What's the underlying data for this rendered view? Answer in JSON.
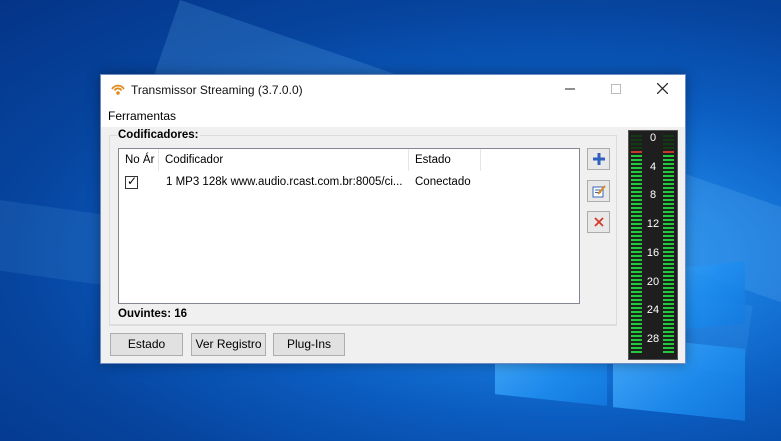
{
  "window": {
    "title": "Transmissor Streaming (3.7.0.0)",
    "controls": {
      "minimize": "—",
      "maximize": "☐",
      "close": "✕"
    }
  },
  "menu": {
    "items": [
      "Ferramentas"
    ]
  },
  "encoders": {
    "group_title": "Codificadores:",
    "columns": [
      "No Ár",
      "Codificador",
      "Estado"
    ],
    "rows": [
      {
        "on_air": true,
        "codificador": "1 MP3 128k  www.audio.rcast.com.br:8005/ci...",
        "estado": "Conectado"
      }
    ]
  },
  "side_buttons": [
    {
      "icon": "add-icon",
      "color": "#2f5fbf"
    },
    {
      "icon": "edit-icon",
      "color": "#3a66b7"
    },
    {
      "icon": "delete-icon",
      "color": "#d23a2a"
    }
  ],
  "listeners": {
    "label": "Ouvintes: 16"
  },
  "buttons": {
    "estado": "Estado",
    "ver_registro": "Ver Registro",
    "plugins": "Plug-Ins"
  },
  "meter": {
    "scale": [
      "0",
      "4",
      "8",
      "12",
      "16",
      "20",
      "24",
      "28"
    ],
    "level_left": 0.93,
    "level_right": 0.93,
    "colors": {
      "green": "#22c93a",
      "red": "#c43a2a",
      "off": "#123b14"
    }
  },
  "colors": {
    "accent": "#0078d7",
    "window_bg": "#f0f0f0"
  }
}
